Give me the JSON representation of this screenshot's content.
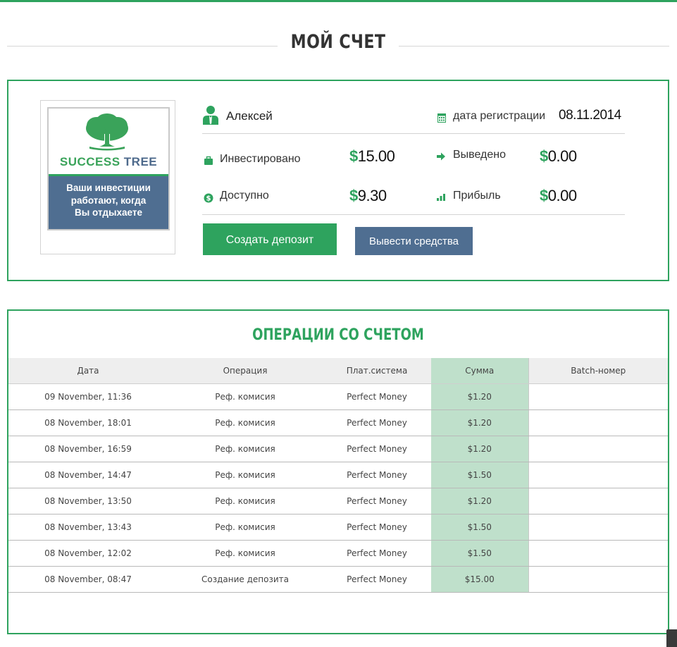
{
  "page": {
    "title": "МОЙ СЧЕТ"
  },
  "logo": {
    "name_part1": "SUCCESS",
    "name_part2": "TREE",
    "slogan": [
      "Ваши инвестиции",
      "работают, когда",
      "Вы отдыхаете"
    ]
  },
  "account": {
    "user_name": "Алексей",
    "registration_label": "дата регистрации",
    "registration_date": "08.11.2014",
    "stats": {
      "invested": {
        "label": "Инвестировано",
        "currency": "$",
        "value": "15.00"
      },
      "withdrawn": {
        "label": "Выведено",
        "currency": "$",
        "value": "0.00"
      },
      "available": {
        "label": "Доступно",
        "currency": "$",
        "value": "9.30"
      },
      "profit": {
        "label": "Прибыль",
        "currency": "$",
        "value": "0.00"
      }
    },
    "buttons": {
      "create_deposit": "Создать депозит",
      "withdraw": "Вывести средства"
    }
  },
  "operations": {
    "title": "ОПЕРАЦИИ СО СЧЕТОМ",
    "columns": [
      "Дата",
      "Операция",
      "Плат.система",
      "Сумма",
      "Batch-номер"
    ],
    "rows": [
      {
        "date": "09 November, 11:36",
        "operation": "Реф. комисия",
        "system": "Perfect Money",
        "amount": "$1.20",
        "batch": ""
      },
      {
        "date": "08 November, 18:01",
        "operation": "Реф. комисия",
        "system": "Perfect Money",
        "amount": "$1.20",
        "batch": ""
      },
      {
        "date": "08 November, 16:59",
        "operation": "Реф. комисия",
        "system": "Perfect Money",
        "amount": "$1.20",
        "batch": ""
      },
      {
        "date": "08 November, 14:47",
        "operation": "Реф. комисия",
        "system": "Perfect Money",
        "amount": "$1.50",
        "batch": ""
      },
      {
        "date": "08 November, 13:50",
        "operation": "Реф. комисия",
        "system": "Perfect Money",
        "amount": "$1.20",
        "batch": ""
      },
      {
        "date": "08 November, 13:43",
        "operation": "Реф. комисия",
        "system": "Perfect Money",
        "amount": "$1.50",
        "batch": ""
      },
      {
        "date": "08 November, 12:02",
        "operation": "Реф. комисия",
        "system": "Perfect Money",
        "amount": "$1.50",
        "batch": ""
      },
      {
        "date": "08 November, 08:47",
        "operation": "Создание депозита",
        "system": "Perfect Money",
        "amount": "$15.00",
        "batch": ""
      }
    ]
  },
  "colors": {
    "accent_green": "#2ea35e",
    "button_blue": "#4f6e91",
    "sum_column_bg": "#bfe0cb"
  },
  "icons": {
    "user": "user-icon",
    "calendar": "calendar-icon",
    "invested": "briefcase-icon",
    "withdrawn": "arrow-right-icon",
    "available": "dollar-coin-icon",
    "profit": "bar-chart-icon"
  }
}
